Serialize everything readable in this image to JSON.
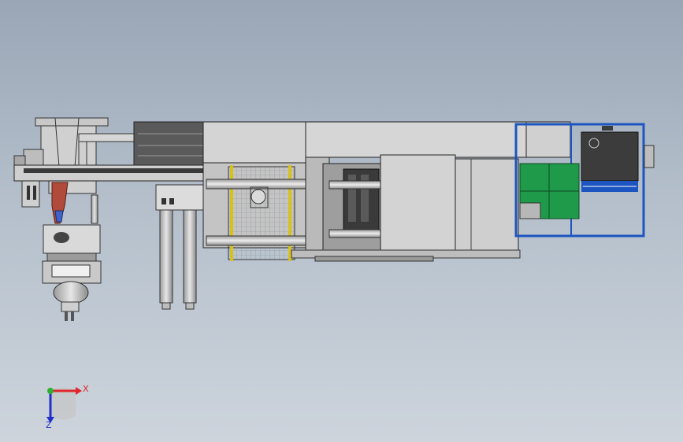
{
  "viewport": {
    "background_top": "#9aa6b6",
    "background_bottom": "#cdd4dc"
  },
  "triad": {
    "x_label": "X",
    "z_label": "Z",
    "x_color": "#e0262b",
    "y_color": "#2fb12f",
    "z_color": "#2030c8"
  },
  "colors": {
    "machine_light": "#d6d6d6",
    "machine_mid": "#b8b8b8",
    "machine_dark": "#3c3c3c",
    "safety_yellow": "#d7c21d",
    "robot_frame_blue": "#1c55c0",
    "control_green": "#1f9a4a",
    "hopper_red": "#b04a3a"
  }
}
